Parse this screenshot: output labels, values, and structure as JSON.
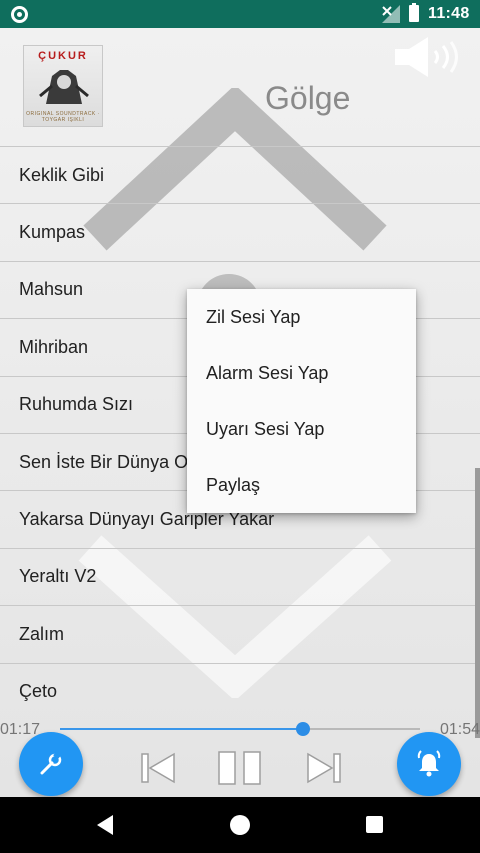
{
  "status_bar": {
    "time": "11:48",
    "bg_color": "#0f6e5d"
  },
  "header": {
    "album_title": "ÇUKUR",
    "album_subtitle": "ORIGINAL SOUNDTRACK · TOYGAR IŞIKLI",
    "song_title": "Gölge"
  },
  "songs": [
    "Keklik Gibi",
    "Kumpas",
    "Mahsun",
    "Mihriban",
    "Ruhumda Sızı",
    "Sen İste Bir Dünya Olayım",
    "Yakarsa Dünyayı Garipler Yakar",
    "Yeraltı V2",
    "Zalım",
    "Çeto"
  ],
  "context_menu": {
    "items": [
      "Zil Sesi Yap",
      "Alarm Sesi Yap",
      "Uyarı Sesi Yap",
      "Paylaş"
    ]
  },
  "player": {
    "current_time": "01:17",
    "total_time": "01:54",
    "progress_fraction": 0.675,
    "accent_color": "#2196f3"
  },
  "icons": {
    "speaker": "speaker-icon",
    "settings": "wrench-icon",
    "prev": "skip-previous-icon",
    "pause": "pause-icon",
    "next": "skip-next-icon",
    "ringtone": "alarm-bell-icon"
  }
}
